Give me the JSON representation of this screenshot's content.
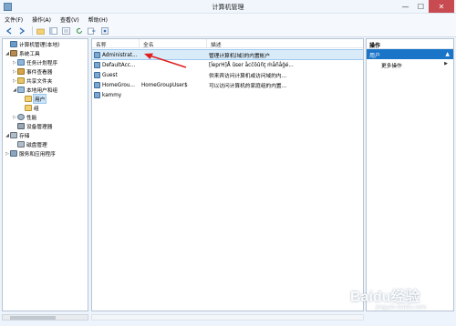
{
  "window": {
    "title": "计算机管理",
    "controls": {
      "minimize": "—",
      "maximize": "☐",
      "close": "✕"
    }
  },
  "menubar": {
    "items": [
      "文件(F)",
      "操作(A)",
      "查看(V)",
      "帮助(H)"
    ]
  },
  "toolbar": {
    "icons": [
      "back-icon",
      "forward-icon",
      "folder-up-icon",
      "show-hide-tree-icon",
      "properties-icon",
      "refresh-icon",
      "export-icon",
      "help-icon"
    ]
  },
  "tree": {
    "root": "计算机管理(本地)",
    "system_tools": "系统工具",
    "task_scheduler": "任务计划程序",
    "event_viewer": "事件查看器",
    "shared_folders": "共享文件夹",
    "local_users": "本地用户和组",
    "users": "用户",
    "groups": "组",
    "performance": "性能",
    "device_manager": "设备管理器",
    "storage": "存储",
    "disk_management": "磁盘管理",
    "services": "服务和应用程序"
  },
  "list": {
    "columns": {
      "name": "名称",
      "fullname": "全名",
      "desc": "描述"
    },
    "rows": [
      {
        "name": "Administrat...",
        "fullname": "",
        "desc": "管理计算机(域)的内置帐户"
      },
      {
        "name": "DefaultAcc...",
        "fullname": "",
        "desc": "[ĺeprH]Å ûser åcĉôûñţ ṁåñåĝé..."
      },
      {
        "name": "Guest",
        "fullname": "",
        "desc": "供来宾访问计算机或访问域的内..."
      },
      {
        "name": "HomeGrou...",
        "fullname": "HomeGroupUser$",
        "desc": "可以访问计算机的家庭组的内置..."
      },
      {
        "name": "kammy",
        "fullname": "",
        "desc": ""
      }
    ]
  },
  "actions": {
    "title": "操作",
    "section": "用户",
    "more": "更多操作"
  },
  "watermark": {
    "main": "Baidu经验",
    "sub": "jingyan.baidu.com"
  },
  "colors": {
    "selection": "#cce4f7",
    "action_header": "#1a74c8",
    "annotation": "#e02020"
  }
}
